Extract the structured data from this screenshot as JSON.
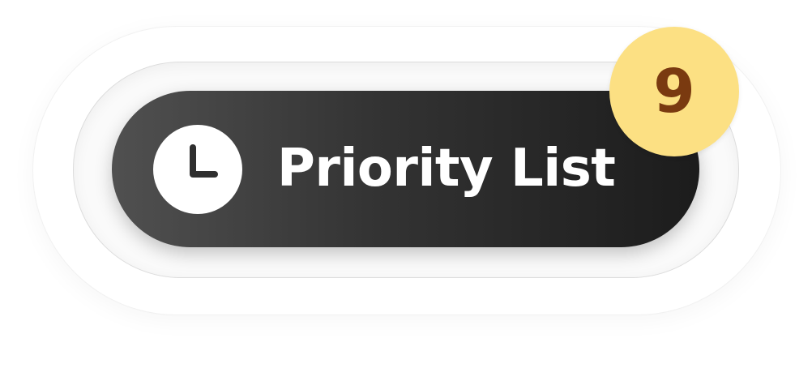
{
  "button": {
    "label": "Priority List",
    "icon": "clock-icon",
    "badge_count": "9"
  },
  "colors": {
    "button_dark": "#1c1c1c",
    "button_light": "#505050",
    "badge_fill": "#fce083",
    "badge_text": "#7a3a10",
    "label_text": "#ffffff"
  }
}
